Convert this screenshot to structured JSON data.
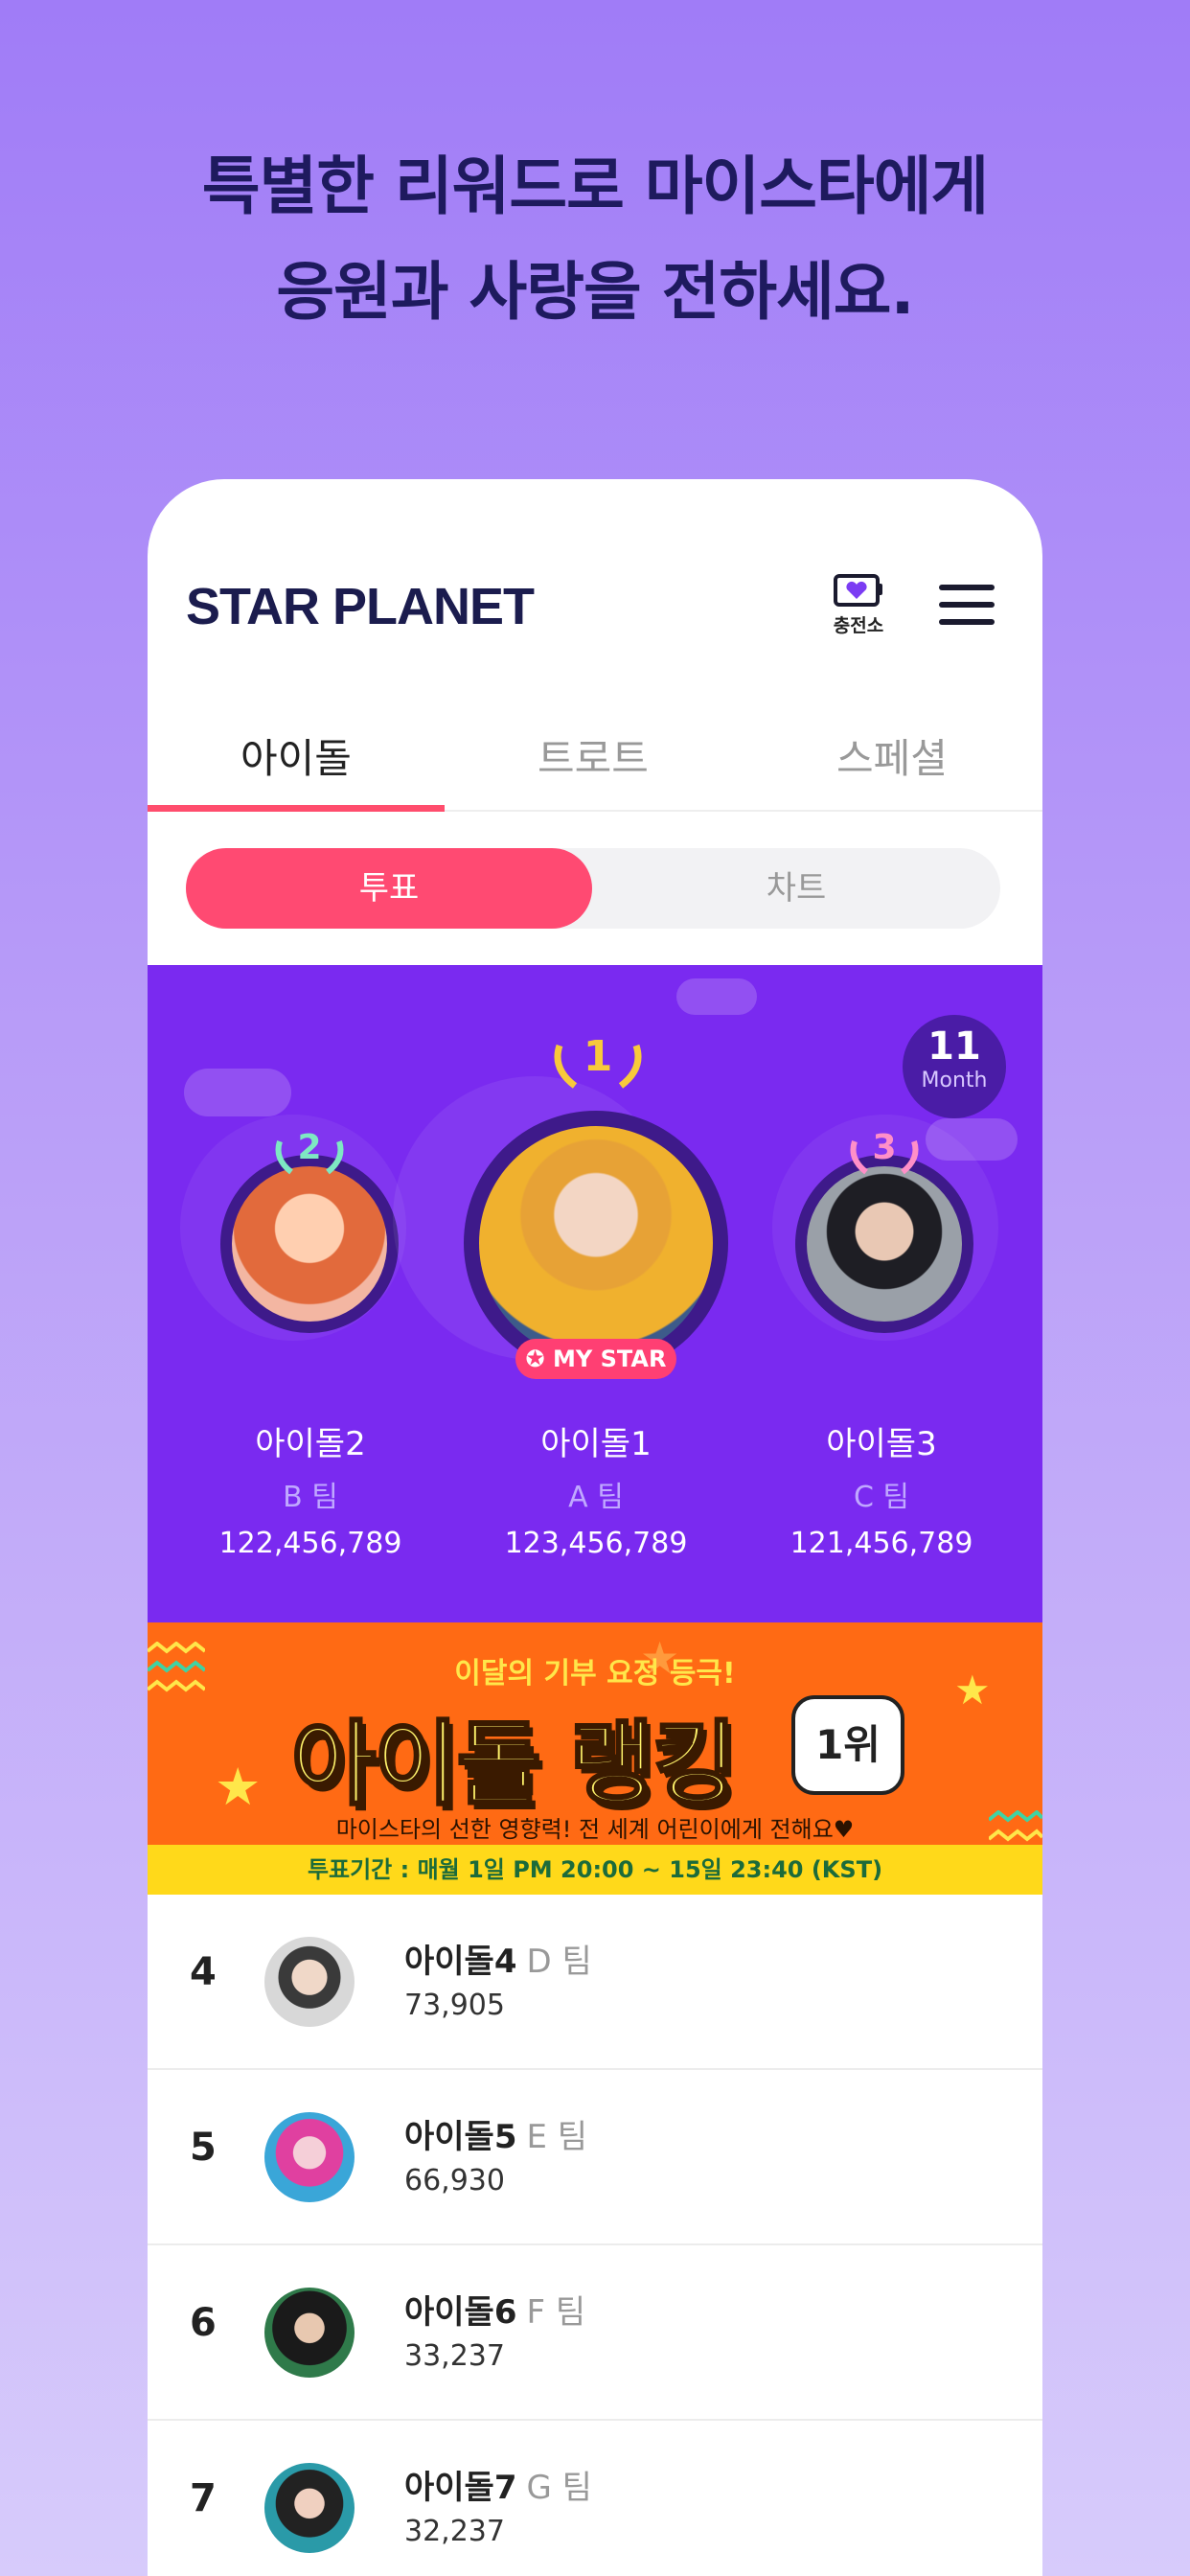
{
  "headline": {
    "line1": "특별한 리워드로 마이스타에게",
    "line2": "응원과 사랑을 전하세요."
  },
  "header": {
    "logo": "STAR PLANET",
    "charge_label": "충전소",
    "charge_icon": "heart-tv-icon",
    "menu_icon": "hamburger-icon"
  },
  "tabs": [
    {
      "label": "아이돌",
      "active": true
    },
    {
      "label": "트로트",
      "active": false
    },
    {
      "label": "스페셜",
      "active": false
    }
  ],
  "segment": {
    "vote": "투표",
    "chart": "차트"
  },
  "month": {
    "number": "11",
    "label": "Month"
  },
  "podium": [
    {
      "rank": "2",
      "name": "아이돌2",
      "team": "B 팀",
      "votes": "122,456,789"
    },
    {
      "rank": "1",
      "name": "아이돌1",
      "team": "A 팀",
      "votes": "123,456,789",
      "badge": "MY STAR"
    },
    {
      "rank": "3",
      "name": "아이돌3",
      "team": "C 팀",
      "votes": "121,456,789"
    }
  ],
  "banner": {
    "top": "이달의 기부 요정 등극!",
    "title": "아이돌 랭킹",
    "badge": "1위",
    "subtitle": "마이스타의 선한 영향력! 전 세계 어린이에게 전해요♥",
    "period": "투표기간 : 매월 1일 PM 20:00 ~ 15일 23:40 (KST)"
  },
  "ranking": [
    {
      "rank": "4",
      "name": "아이돌4",
      "team": "D 팀",
      "votes": "73,905"
    },
    {
      "rank": "5",
      "name": "아이돌5",
      "team": "E 팀",
      "votes": "66,930"
    },
    {
      "rank": "6",
      "name": "아이돌6",
      "team": "F 팀",
      "votes": "33,237"
    },
    {
      "rank": "7",
      "name": "아이돌7",
      "team": "G 팀",
      "votes": "32,237"
    }
  ],
  "colors": {
    "accent": "#ff4a72",
    "podium_bg": "#7a2af0",
    "banner_bg": "#ff6a14"
  }
}
